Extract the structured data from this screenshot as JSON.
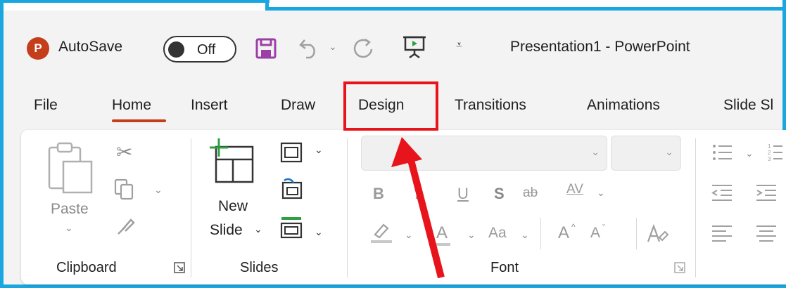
{
  "app": {
    "logo_letter": "P",
    "autosave_label": "AutoSave",
    "autosave_state": "Off",
    "window_title": "Presentation1  -  PowerPoint"
  },
  "tabs": [
    {
      "label": "File"
    },
    {
      "label": "Home",
      "selected": true
    },
    {
      "label": "Insert"
    },
    {
      "label": "Draw"
    },
    {
      "label": "Design",
      "highlighted": true
    },
    {
      "label": "Transitions"
    },
    {
      "label": "Animations"
    },
    {
      "label": "Slide Sl"
    }
  ],
  "clipboard": {
    "paste_label": "Paste",
    "group_label": "Clipboard"
  },
  "slides": {
    "new_slide_line1": "New",
    "new_slide_line2": "Slide",
    "group_label": "Slides"
  },
  "font": {
    "bold": "B",
    "italic": "I",
    "underline": "U",
    "shadow": "S",
    "strikethrough": "ab",
    "spacing": "AV",
    "change_case": "Aa",
    "grow": "A",
    "shrink": "A",
    "group_label": "Font"
  },
  "colors": {
    "accent_red": "#c43e1c",
    "highlight_box": "#e8141c",
    "annotation_arrow": "#e8141c",
    "frame_border": "#1aa7e0",
    "qat_save": "#9b3fa6",
    "green": "#2ea043"
  },
  "icons": [
    "powerpoint-logo-icon",
    "save-icon",
    "undo-icon",
    "redo-icon",
    "present-from-beginning-icon",
    "customize-qat-icon",
    "paste-icon",
    "cut-icon",
    "copy-icon",
    "format-painter-icon",
    "new-slide-icon",
    "layout-icon",
    "reset-icon",
    "section-icon",
    "highlighter-icon",
    "font-color-icon",
    "clear-formatting-icon",
    "bullets-icon",
    "numbering-icon",
    "decrease-indent-icon",
    "increase-indent-icon",
    "align-left-icon",
    "center-icon",
    "dialog-launcher-icon"
  ]
}
